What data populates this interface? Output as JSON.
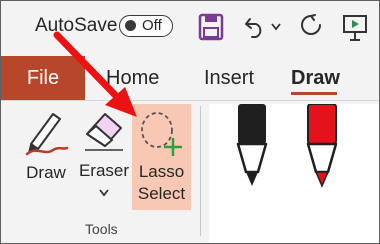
{
  "qat": {
    "autosave_label": "AutoSave",
    "toggle_state": "Off",
    "icons": [
      "save-icon",
      "undo-icon",
      "undo-dropdown-icon",
      "redo-icon",
      "present-icon"
    ]
  },
  "tabs": [
    {
      "label": "File"
    },
    {
      "label": "Home"
    },
    {
      "label": "Insert"
    },
    {
      "label": "Draw",
      "active": true
    }
  ],
  "ribbon": {
    "tools": [
      {
        "label": "Draw",
        "icon": "pen-icon"
      },
      {
        "label": "Eraser",
        "icon": "eraser-icon",
        "dropdown": true
      },
      {
        "label_line1": "Lasso",
        "label_line2": "Select",
        "icon": "lasso-select-icon",
        "highlighted": true
      }
    ],
    "group_label": "Tools",
    "pens": [
      {
        "icon": "black-pen-icon",
        "color": "#1f1f1f"
      },
      {
        "icon": "red-pen-icon",
        "color": "#e3121b"
      }
    ]
  },
  "colors": {
    "file_tab": "#b7472a",
    "highlight": "#f8c8b4",
    "annotation_arrow": "#ee1111",
    "save_icon": "#7b3a96"
  }
}
